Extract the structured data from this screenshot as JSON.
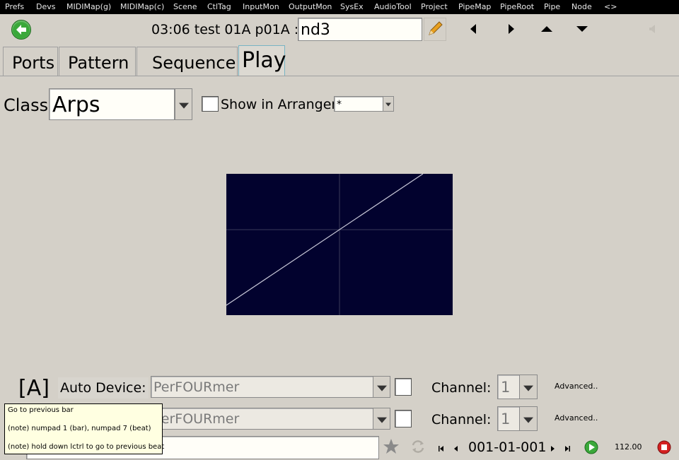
{
  "menu": [
    "Prefs",
    "Devs",
    "MIDIMap(g)",
    "MIDIMap(c)",
    "Scene",
    "CtlTag",
    "InputMon",
    "OutputMon",
    "SysEx",
    "AudioTool",
    "Project",
    "PipeMap",
    "PipeRoot",
    "Pipe",
    "Node",
    "<>"
  ],
  "header": {
    "title": "03:06 test  01A  p01A :",
    "name_value": "nd3"
  },
  "tabs": [
    "Ports",
    "Pattern",
    "Sequence",
    "Play"
  ],
  "class_row": {
    "class_label": "Class:",
    "class_value": "Arps",
    "show_in_arranger_label": "Show in Arranger",
    "arranger_value": "*"
  },
  "device_rows": [
    {
      "tag": "[A]",
      "device_label": "Auto Device:",
      "device_value": "PerFOURmer",
      "channel_label": "Channel:",
      "channel_value": "1",
      "advanced_label": "Advanced.."
    },
    {
      "device_value": "PerFOURmer",
      "channel_label": "Channel:",
      "channel_value": "1",
      "advanced_label": "Advanced.."
    }
  ],
  "tooltip": {
    "title": "Go to previous bar",
    "line1": "(note) numpad 1 (bar), numpad 7 (beat)",
    "line2": "(note) hold down lctrl to go to previous beat"
  },
  "transport": {
    "position": "001-01-001",
    "tempo": "112.00"
  },
  "colors": {
    "graph_background": "#02022e",
    "graph_line": "#c8c8d8",
    "accent_green": "#3aa83a",
    "stop_red": "#d42020"
  }
}
